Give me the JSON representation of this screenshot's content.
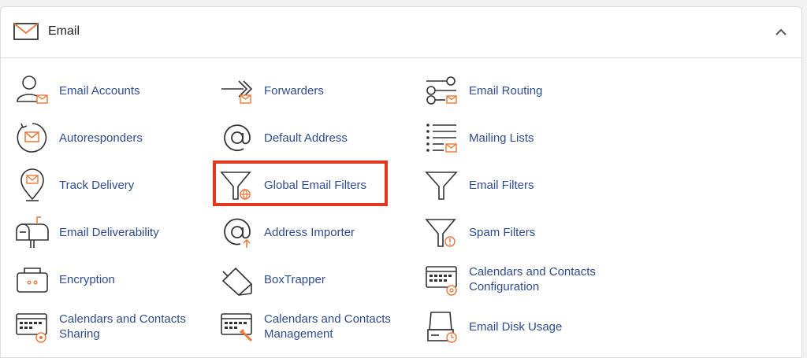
{
  "section": {
    "title": "Email",
    "collapse_icon": "chevron-up-icon"
  },
  "items": [
    {
      "label": "Email Accounts",
      "icon": "email-accounts-icon"
    },
    {
      "label": "Forwarders",
      "icon": "forwarders-icon"
    },
    {
      "label": "Email Routing",
      "icon": "email-routing-icon"
    },
    {
      "label": "Autoresponders",
      "icon": "autoresponders-icon"
    },
    {
      "label": "Default Address",
      "icon": "at-sign-icon"
    },
    {
      "label": "Mailing Lists",
      "icon": "mailing-lists-icon"
    },
    {
      "label": "Track Delivery",
      "icon": "map-pin-icon"
    },
    {
      "label": "Global Email Filters",
      "icon": "funnel-globe-icon"
    },
    {
      "label": "Email Filters",
      "icon": "funnel-icon"
    },
    {
      "label": "Email Deliverability",
      "icon": "mailbox-icon"
    },
    {
      "label": "Address Importer",
      "icon": "at-import-icon"
    },
    {
      "label": "Spam Filters",
      "icon": "funnel-warning-icon"
    },
    {
      "label": "Encryption",
      "icon": "encryption-icon"
    },
    {
      "label": "BoxTrapper",
      "icon": "boxtrapper-icon"
    },
    {
      "label": "Calendars and Contacts\nConfiguration",
      "icon": "calendar-at-icon"
    },
    {
      "label": "Calendars and Contacts\nSharing",
      "icon": "calendar-share-icon"
    },
    {
      "label": "Calendars and Contacts\nManagement",
      "icon": "calendar-manage-icon"
    },
    {
      "label": "Email Disk Usage",
      "icon": "disk-usage-icon"
    }
  ],
  "colors": {
    "accent": "#e8773a",
    "link": "#2f4c8f",
    "highlight": "#e2361f"
  }
}
